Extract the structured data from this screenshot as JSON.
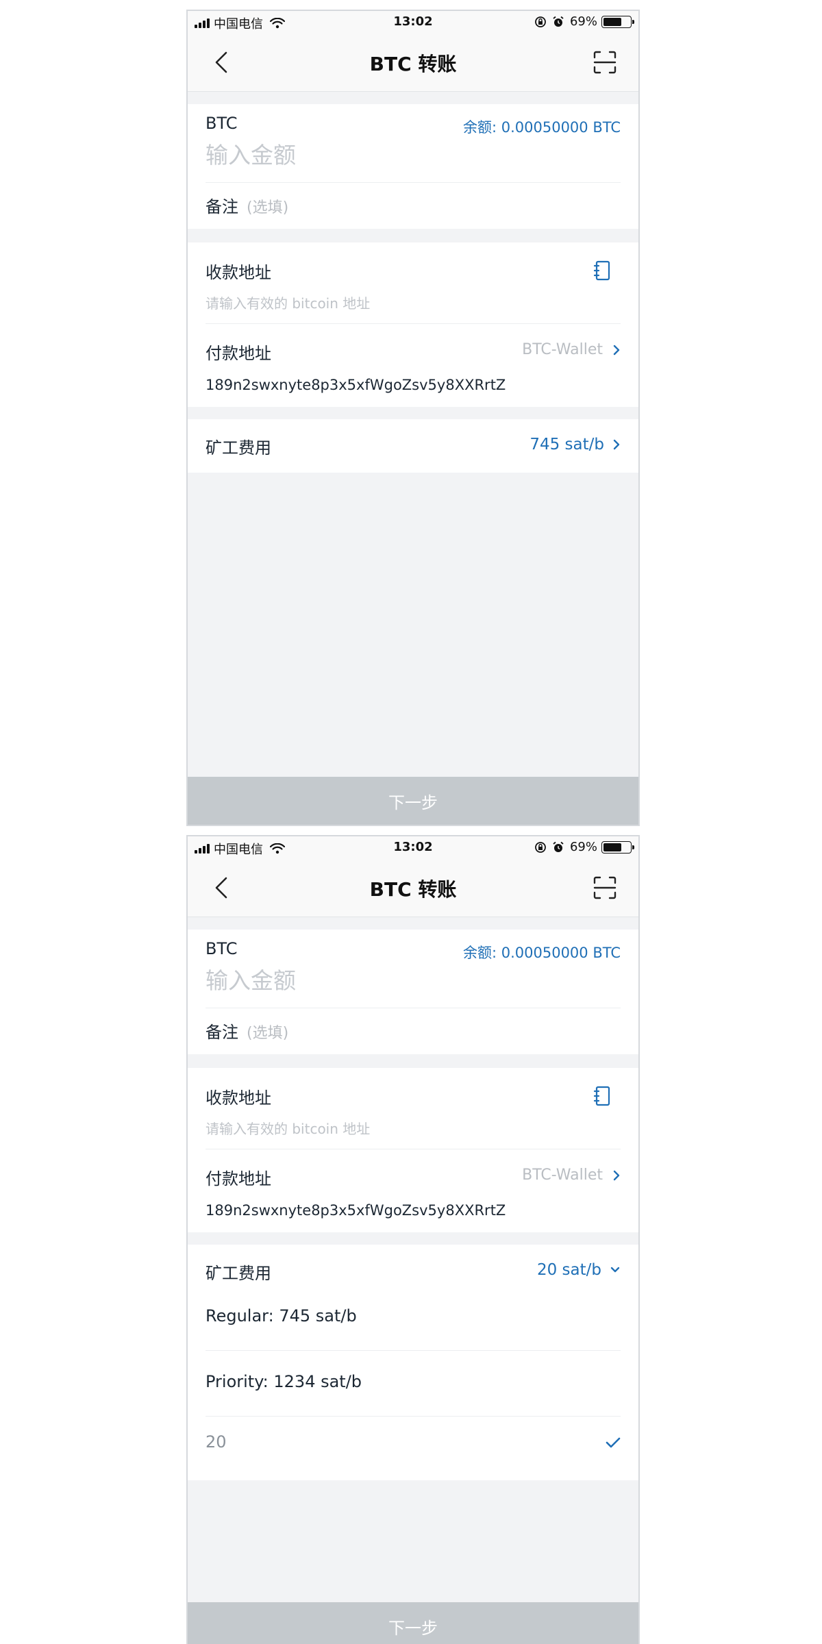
{
  "status_bar": {
    "carrier": "中国电信",
    "time": "13:02",
    "battery_text": "69%",
    "battery_level": 0.69,
    "icons": [
      "signal-icon",
      "wifi-icon",
      "rotation-lock-icon",
      "alarm-icon",
      "battery-icon"
    ]
  },
  "nav": {
    "title": "BTC 转账",
    "back_icon": "chevron-left-icon",
    "scan_icon": "scan-icon"
  },
  "amount": {
    "coin": "BTC",
    "balance": "余额: 0.00050000 BTC",
    "placeholder": "输入金额",
    "note_label": "备注",
    "note_hint": "(选填)"
  },
  "address": {
    "receive_label": "收款地址",
    "receive_placeholder": "请输入有效的 bitcoin 地址",
    "address_book_icon": "address-book-icon",
    "pay_label": "付款地址",
    "wallet_name": "BTC-Wallet",
    "pay_address": "189n2swxnyte8p3x5xfWgoZsv5y8XXRrtZ"
  },
  "screens": [
    {
      "fee_label": "矿工费用",
      "fee_value": "745 sat/b",
      "fee_expanded": false
    },
    {
      "fee_label": "矿工费用",
      "fee_value": "20 sat/b",
      "fee_expanded": true,
      "fee_options": [
        {
          "label": "Regular: 745 sat/b",
          "selected": false
        },
        {
          "label": "Priority: 1234 sat/b",
          "selected": false
        },
        {
          "label": "20",
          "selected": true
        }
      ]
    }
  ],
  "next_button": "下一步",
  "colors": {
    "accent": "#1f6fb6",
    "background": "#f2f3f5",
    "button_disabled": "#c4c9cd",
    "placeholder": "#c6cacf"
  }
}
